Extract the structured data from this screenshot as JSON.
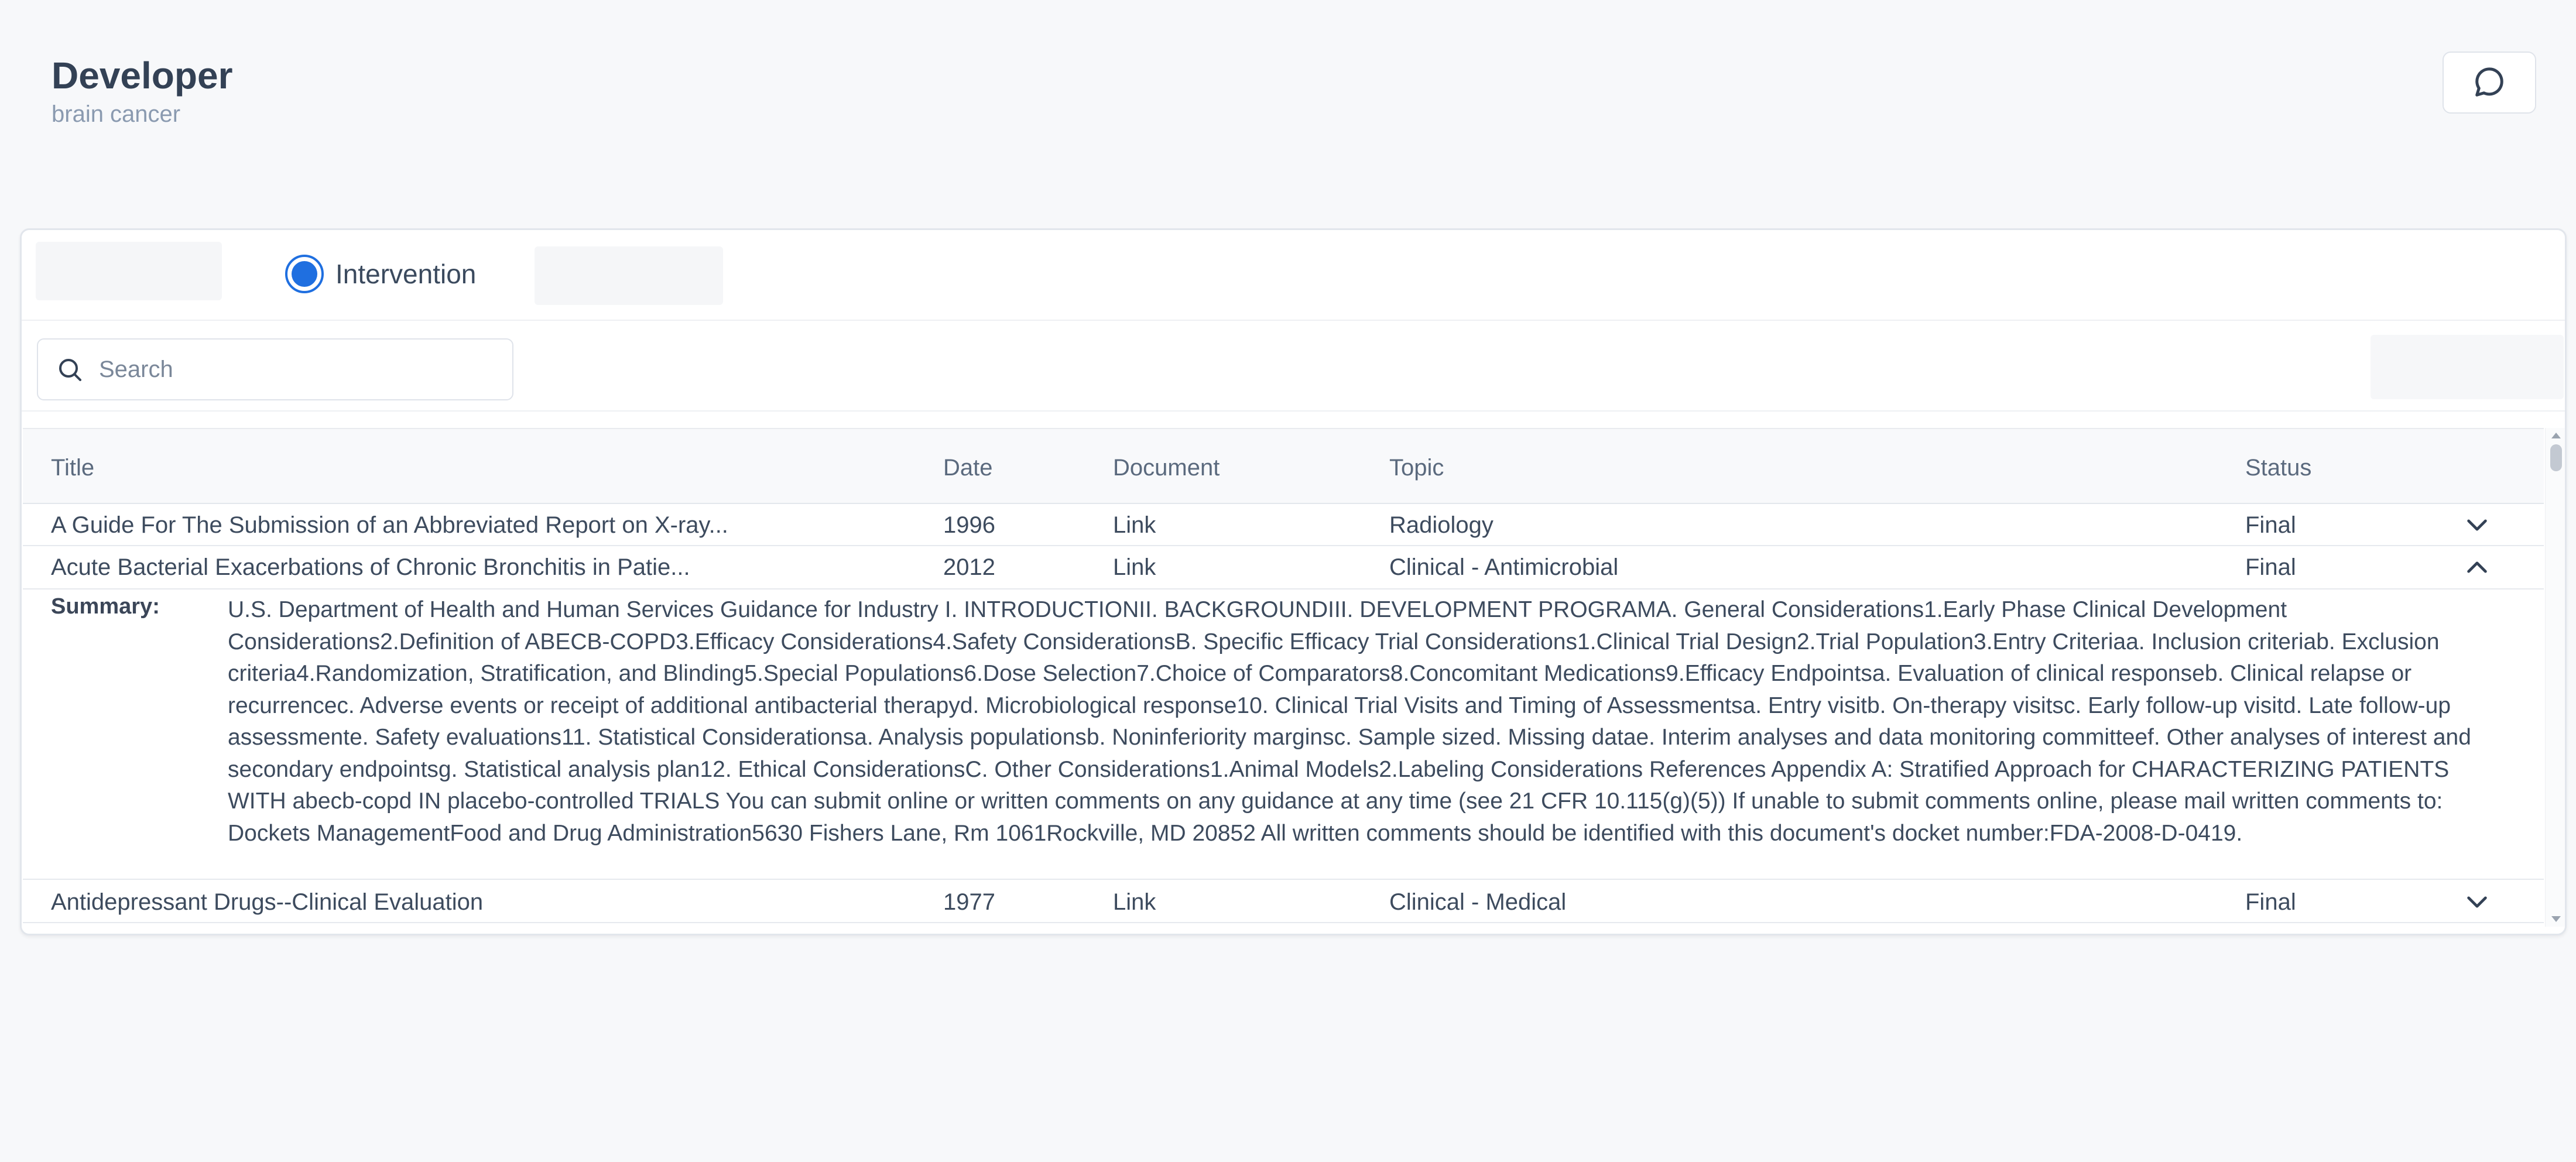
{
  "header": {
    "title": "Developer",
    "subtitle": "brain cancer",
    "chat_icon": "chat-bubble-icon"
  },
  "filters": {
    "selected_option": "Intervention"
  },
  "search": {
    "placeholder": "Search",
    "value": ""
  },
  "table": {
    "columns": {
      "title": "Title",
      "date": "Date",
      "document": "Document",
      "topic": "Topic",
      "status": "Status"
    },
    "rows": [
      {
        "title": "A Guide For The Submission of an Abbreviated Report on X-ray...",
        "date": "1996",
        "document": "Link",
        "topic": "Radiology",
        "status": "Final",
        "expanded": false
      },
      {
        "title": "Acute Bacterial Exacerbations of Chronic Bronchitis in Patie...",
        "date": "2012",
        "document": "Link",
        "topic": "Clinical - Antimicrobial",
        "status": "Final",
        "expanded": true,
        "summary_label": "Summary:",
        "summary": "U.S. Department of Health and Human Services Guidance for Industry I. INTRODUCTIONII. BACKGROUNDIII. DEVELOPMENT PROGRAMA. General Considerations1.Early Phase Clinical Development Considerations2.Definition of ABECB-COPD3.Efficacy Considerations4.Safety ConsiderationsB. Specific Efficacy Trial Considerations1.Clinical Trial Design2.Trial Population3.Entry Criteriaa. Inclusion criteriab. Exclusion criteria4.Randomization, Stratification, and Blinding5.Special Populations6.Dose Selection7.Choice of Comparators8.Concomitant Medications9.Efficacy Endpointsa. Evaluation of clinical responseb. Clinical relapse or recurrencec. Adverse events or receipt of additional antibacterial therapyd. Microbiological response10. Clinical Trial Visits and Timing of Assessmentsa. Entry visitb. On-therapy visitsc. Early follow-up visitd. Late follow-up assessmente. Safety evaluations11. Statistical Considerationsa. Analysis populationsb. Noninferiority marginsc. Sample sized. Missing datae. Interim analyses and data monitoring committeef. Other analyses of interest and secondary endpointsg. Statistical analysis plan12. Ethical ConsiderationsC. Other Considerations1.Animal Models2.Labeling Considerations References Appendix A: Stratified Approach for CHARACTERIZING PATIENTS WITH abecb-copd IN placebo-controlled TRIALS You can submit online or written comments on any guidance at any time (see 21 CFR 10.115(g)(5)) If unable to submit comments online, please mail written comments to: Dockets ManagementFood and Drug Administration5630 Fishers Lane, Rm 1061Rockville, MD 20852 All written comments should be identified with this document's docket number:FDA-2008-D-0419."
      },
      {
        "title": "Antidepressant Drugs--Clinical Evaluation",
        "date": "1977",
        "document": "Link",
        "topic": "Clinical - Medical",
        "status": "Final",
        "expanded": false
      }
    ]
  },
  "colors": {
    "accent": "#1f6fe0",
    "background": "#f7f8fa",
    "text": "#334155"
  }
}
